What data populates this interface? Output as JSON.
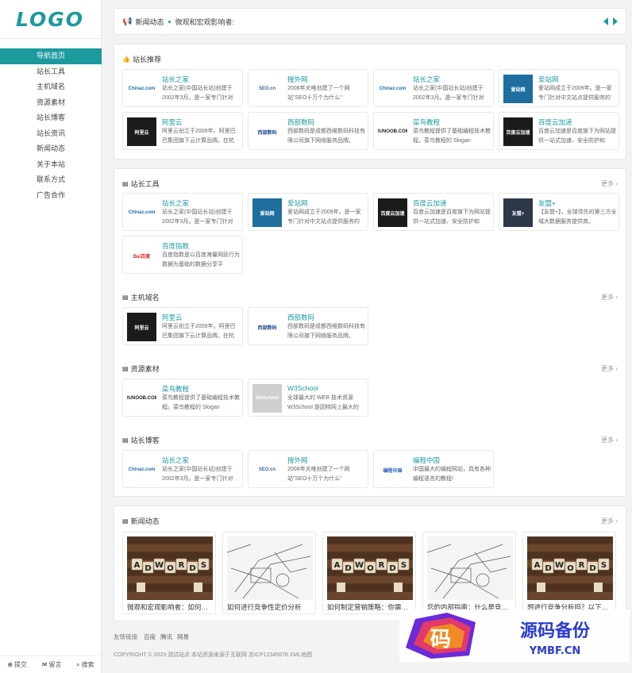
{
  "logo": "LOGO",
  "nav": [
    "导航首页",
    "站长工具",
    "主机域名",
    "资源素材",
    "站长博客",
    "站长资讯",
    "新闻动态",
    "关于本站",
    "联系方式",
    "广告合作"
  ],
  "side_footer": {
    "submit": "提交",
    "message": "留言",
    "search": "搜索"
  },
  "ticker": {
    "title": "新闻动态",
    "text": "微观和宏观影响者:"
  },
  "sections": [
    {
      "title": "站长推荐",
      "more": "",
      "cards": [
        {
          "name": "站长之家",
          "desc": "站长之家(中国站长站)创建于2002年3月。是一家专门针对",
          "thumb": "Chinaz.com"
        },
        {
          "name": "搜外网",
          "desc": "2008年夫唯创建了一个网站\"SEO十万个为什么\"",
          "thumb": "SEO.cn"
        },
        {
          "name": "站长之家",
          "desc": "站长之家(中国站长站)创建于2002年3月。是一家专门针对",
          "thumb": "Chinaz.com"
        },
        {
          "name": "爱站网",
          "desc": "爱站网成立于2009年。是一家专门针对中文站点提供服务的",
          "thumb": "爱站网"
        },
        {
          "name": "阿里云",
          "desc": "阿里云创立于2009年。阿里巴巴集团旗下云计算品牌。在杭",
          "thumb": "阿里云"
        },
        {
          "name": "西部数码",
          "desc": "西部数码是成都西维数码科技有限公司旗下网络服务品牌。",
          "thumb": "西部数码"
        },
        {
          "name": "菜鸟教程",
          "desc": "菜鸟教程提供了基础编程技术教程。菜鸟教程的 Slogan",
          "thumb": "RUNOOB.COM"
        },
        {
          "name": "百度云加速",
          "desc": "百度云加速是百度旗下为网站提供一站式加速、安全防护和",
          "thumb": "百度云加速"
        }
      ]
    },
    {
      "title": "站长工具",
      "more": "更多",
      "cards": [
        {
          "name": "站长之家",
          "desc": "站长之家(中国站长站)创建于2002年3月。是一家专门针对",
          "thumb": "Chinaz.com"
        },
        {
          "name": "爱站网",
          "desc": "爱站网成立于2009年。是一家专门针对中文站点提供服务的",
          "thumb": "爱站网"
        },
        {
          "name": "百度云加速",
          "desc": "百度云加速是百度旗下为网站提供一站式加速、安全防护和",
          "thumb": "百度云加速"
        },
        {
          "name": "友盟+",
          "desc": "【友盟+】，全球领先的第三方全域大数据服务提供商。",
          "thumb": "友盟+"
        },
        {
          "name": "百度指数",
          "desc": "百度指数是以百度海量网民行为数据为基础的数据分享平",
          "thumb": "Bai百度"
        }
      ]
    },
    {
      "title": "主机域名",
      "more": "更多",
      "cards": [
        {
          "name": "阿里云",
          "desc": "阿里云创立于2009年。阿里巴巴集团旗下云计算品牌。在杭",
          "thumb": "阿里云"
        },
        {
          "name": "西部数码",
          "desc": "西部数码是成都西维数码科技有限公司旗下网络服务品牌。",
          "thumb": "西部数码"
        }
      ]
    },
    {
      "title": "资源素材",
      "more": "更多",
      "cards": [
        {
          "name": "菜鸟教程",
          "desc": "菜鸟教程提供了基础编程技术教程。菜鸟教程的 Slogan",
          "thumb": "RUNOOB.COM"
        },
        {
          "name": "W3School",
          "desc": "全球最大的 WEB 技术资源 W3School 是因特网上最大的",
          "thumb": "W3School"
        }
      ]
    },
    {
      "title": "站长博客",
      "more": "更多",
      "cards": [
        {
          "name": "站长之家",
          "desc": "站长之家(中国站长站)创建于2002年3月。是一家专门针对",
          "thumb": "Chinaz.com"
        },
        {
          "name": "搜外网",
          "desc": "2008年夫唯创建了一个网站\"SEO十万个为什么\"",
          "thumb": "SEO.cn"
        },
        {
          "name": "编程中国",
          "desc": "中国最大的编程网站，具有各种编程语言的教程!",
          "thumb": "编程中国"
        }
      ]
    }
  ],
  "news": {
    "title": "新闻动态",
    "more": "更多",
    "items": [
      {
        "caption": "微观和宏观影响者：如何…",
        "image": "adwords"
      },
      {
        "caption": "如何进行竞争性定价分析",
        "image": "blueprint"
      },
      {
        "caption": "如何制定营销策略：你需…",
        "image": "adwords"
      },
      {
        "caption": "您的内部指南：什么是竞…",
        "image": "blueprint"
      },
      {
        "caption": "想进行竞争分析吗？以下…",
        "image": "adwords"
      }
    ]
  },
  "footer": {
    "links_label": "友情链接:",
    "links": [
      "百度",
      "腾讯",
      "网易"
    ],
    "copyright": "COPYRIGHT © 2023 测试站点 本站资源来源于互联网 苏ICP12345678 XML地图"
  },
  "watermark": {
    "brand": "源码备份",
    "domain": "YMBF.CN",
    "glyph": "码"
  },
  "colors": {
    "accent": "#1c9a9e"
  }
}
